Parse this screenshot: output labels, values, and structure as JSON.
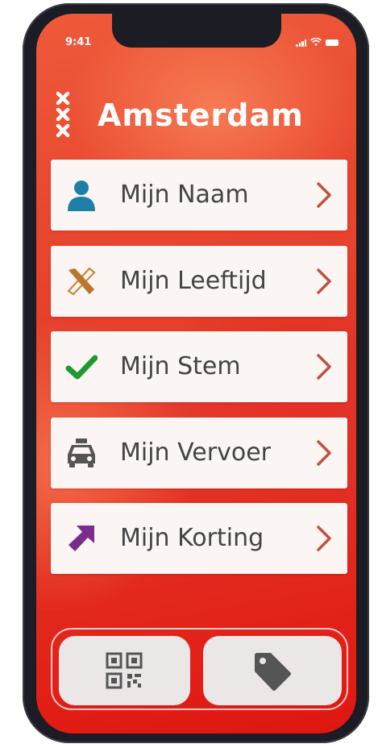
{
  "status_bar": {
    "time": "9:41"
  },
  "header": {
    "title": "Amsterdam"
  },
  "menu": [
    {
      "label": "Mijn Naam",
      "icon": "person-icon"
    },
    {
      "label": "Mijn Leeftijd",
      "icon": "crossed-bandage-icon"
    },
    {
      "label": "Mijn Stem",
      "icon": "checkmark-icon"
    },
    {
      "label": "Mijn Vervoer",
      "icon": "taxi-icon"
    },
    {
      "label": "Mijn Korting",
      "icon": "arrow-up-right-icon"
    }
  ],
  "bottom_tabs": [
    {
      "icon": "qr-code-icon"
    },
    {
      "icon": "price-tag-icon"
    }
  ],
  "colors": {
    "accent_chevron": "#c0513f",
    "person_icon": "#1f7fa6",
    "check_icon": "#1f9a2e",
    "discount_arrow": "#7b2d8e",
    "age_icon": "#c88a3a"
  }
}
